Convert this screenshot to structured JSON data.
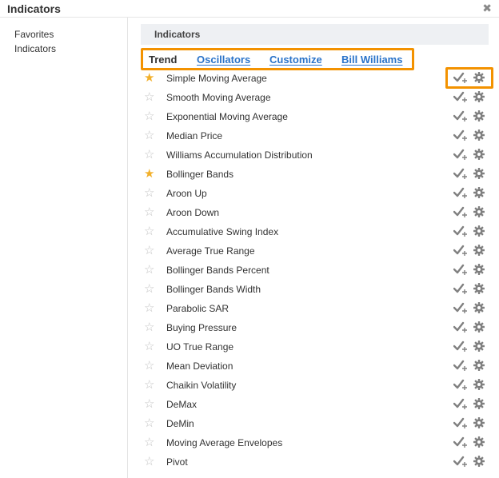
{
  "dialog": {
    "title": "Indicators",
    "close_icon": "close-icon"
  },
  "sidebar": {
    "items": [
      {
        "label": "Favorites"
      },
      {
        "label": "Indicators"
      }
    ]
  },
  "main": {
    "section_title": "Indicators",
    "tabs": [
      {
        "label": "Trend",
        "active": true
      },
      {
        "label": "Oscillators",
        "active": false
      },
      {
        "label": "Customize",
        "active": false
      },
      {
        "label": "Bill Williams",
        "active": false
      }
    ],
    "indicators": [
      {
        "name": "Simple Moving Average",
        "favorite": true
      },
      {
        "name": "Smooth Moving Average",
        "favorite": false
      },
      {
        "name": "Exponential Moving Average",
        "favorite": false
      },
      {
        "name": "Median Price",
        "favorite": false
      },
      {
        "name": "Williams Accumulation Distribution",
        "favorite": false
      },
      {
        "name": "Bollinger Bands",
        "favorite": true
      },
      {
        "name": "Aroon Up",
        "favorite": false
      },
      {
        "name": "Aroon Down",
        "favorite": false
      },
      {
        "name": "Accumulative Swing Index",
        "favorite": false
      },
      {
        "name": "Average True Range",
        "favorite": false
      },
      {
        "name": "Bollinger Bands Percent",
        "favorite": false
      },
      {
        "name": "Bollinger Bands Width",
        "favorite": false
      },
      {
        "name": "Parabolic SAR",
        "favorite": false
      },
      {
        "name": "Buying Pressure",
        "favorite": false
      },
      {
        "name": "UO True Range",
        "favorite": false
      },
      {
        "name": "Mean Deviation",
        "favorite": false
      },
      {
        "name": "Chaikin Volatility",
        "favorite": false
      },
      {
        "name": "DeMax",
        "favorite": false
      },
      {
        "name": "DeMin",
        "favorite": false
      },
      {
        "name": "Moving Average Envelopes",
        "favorite": false
      },
      {
        "name": "Pivot",
        "favorite": false
      }
    ]
  },
  "colors": {
    "highlight": "#f39200",
    "link": "#2a73c9",
    "star_on": "#f2b02b",
    "star_off": "#c4c4c4",
    "icon": "#808080"
  }
}
